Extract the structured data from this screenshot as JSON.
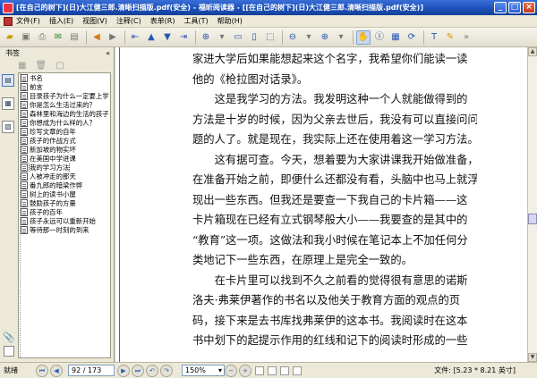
{
  "window": {
    "title": "[在自己的树下](日)大江健三郎.清晰扫描版.pdf(安全) - 福昕阅读器 - [[在自己的树下](日)大江健三郎.清晰扫描版.pdf(安全)]",
    "minimize": "_",
    "maximize": "□",
    "close": "×"
  },
  "menu": [
    "文件(F)",
    "插入(E)",
    "视图(V)",
    "注释(C)",
    "表单(R)",
    "工具(T)",
    "帮助(H)"
  ],
  "sidebar": {
    "header": "书签",
    "collapse": "«",
    "tool_expand": "▦",
    "tool_delete": "🗑",
    "tool_options": "▢",
    "bookmarks": [
      "书名",
      "前言",
      "目录孩子为什么一定要上学",
      "你是怎么生活过来的？",
      "森林里和海边的生活的孩子",
      "你想成为什么样的人？",
      "珍写文章的自年",
      "孩子的作战方式",
      "新加坡的物实坏",
      "在美国中学进课",
      "我的学习方法",
      "人被冲走的那天",
      "番九郎的暗梁作弊",
      "树上的读书小屋",
      "鼓励孩子的方量",
      "孩子的百年",
      "孩子永远可以重新开始",
      "等待那一时刻的到来"
    ],
    "selected_index": 10
  },
  "document": {
    "lines": [
      "家进大学后如果能想起来这个名字，我希望你们能读一读",
      "他的《枪拉图对话录》。",
      "　　这是我学习的方法。我发明这种一个人就能做得到的",
      "方法是十岁的时候，因为父亲去世后，我没有可以直接问问",
      "题的人了。就是现在，我实际上还在使用着这一学习方法。",
      "　　这有据可查。今天，想着要为大家讲课我开始做准备，",
      "在准备开始之前，即便什么还都没有看，头脑中也马上就浮",
      "现出一些东西。但我还是要查一下我自己的卡片箱——这",
      "卡片箱现在已经有立式钢琴般大小——我要查的是其中的",
      "“教育”这一项。这做法和我小时候在笔记本上不加任何分",
      "类地记下一些东西，在原理上是完全一致的。",
      "　　在卡片里可以找到不久之前看的觉得很有意思的诺斯",
      "洛夫·弗莱伊著作的书名以及他关于教育方面的观点的页",
      "码，接下来是去书库找弗莱伊的这本书。我阅读时在这本",
      "书中划下的起提示作用的红线和记下的阅读时形成的一些"
    ]
  },
  "statusbar": {
    "ready": "就绪",
    "page_input": "92 / 173",
    "zoom": "150%",
    "page_size": "文件: [5.23 * 8.21 英寸]"
  },
  "colors": {
    "titlebar": "#1b4fb6",
    "background": "#ece9d8",
    "page": "#ffffff"
  }
}
